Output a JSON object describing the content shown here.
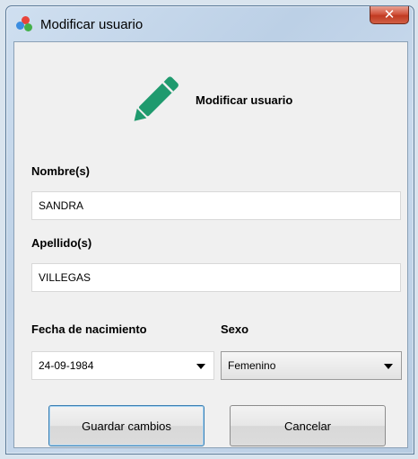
{
  "window": {
    "title": "Modificar usuario",
    "close_glyph": "✕"
  },
  "header": {
    "title": "Modificar usuario",
    "icon": "pencil-icon",
    "accent": "#1f9a6e"
  },
  "form": {
    "nombre": {
      "label": "Nombre(s)",
      "value": "SANDRA"
    },
    "apellido": {
      "label": "Apellido(s)",
      "value": "VILLEGAS"
    },
    "fecha": {
      "label": "Fecha de nacimiento",
      "value": "24-09-1984"
    },
    "sexo": {
      "label": "Sexo",
      "value": "Femenino"
    }
  },
  "buttons": {
    "save": "Guardar cambios",
    "cancel": "Cancelar"
  }
}
